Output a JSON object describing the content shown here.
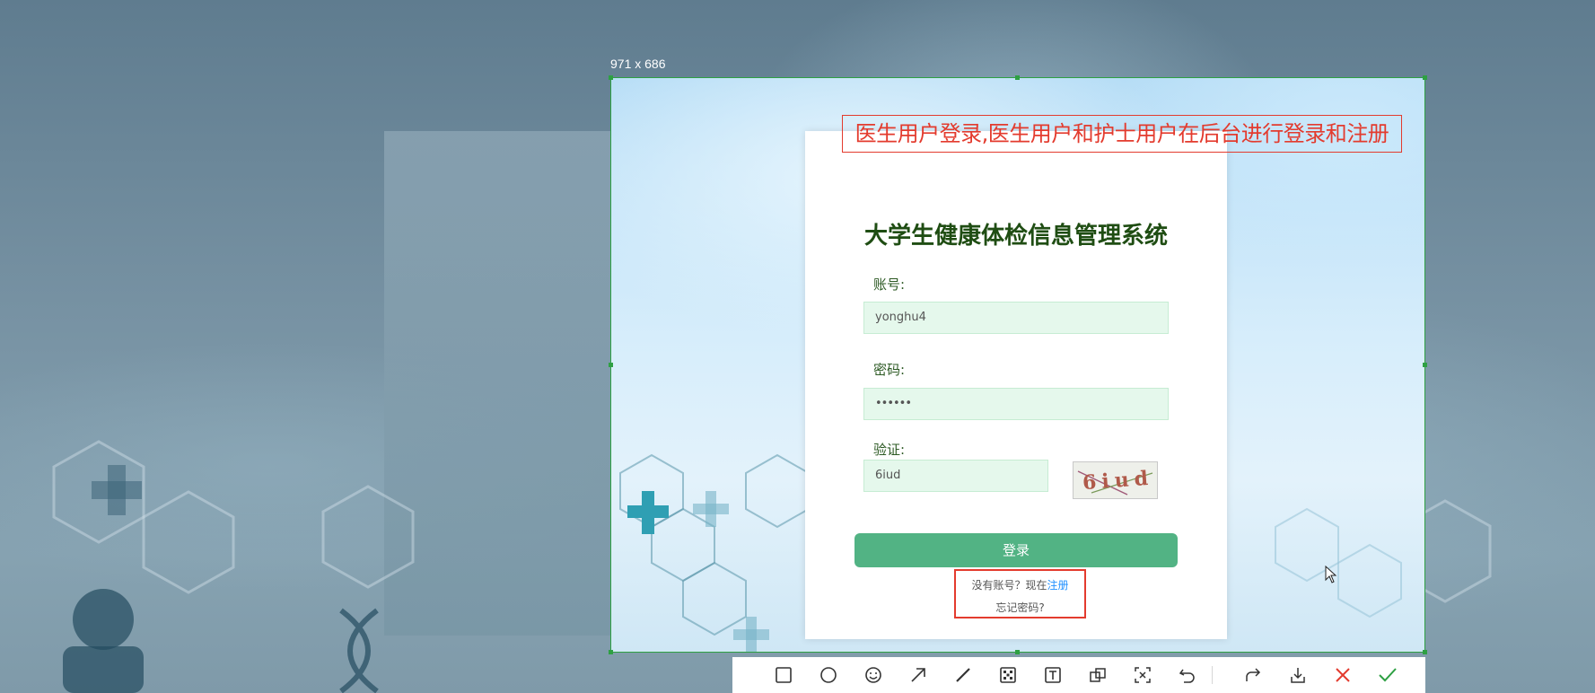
{
  "capture": {
    "size_label": "971 x 686"
  },
  "annotation": {
    "text": "医生用户登录,医生用户和护士用户在后台进行登录和注册"
  },
  "login": {
    "title": "大学生健康体检信息管理系统",
    "account_label": "账号:",
    "account_value": "yonghu4",
    "password_label": "密码:",
    "password_value": "••••••",
    "captcha_label": "验证:",
    "captcha_value": "6iud",
    "captcha_image_text": "6iud",
    "login_button": "登录",
    "register_prompt": "没有账号？现在",
    "register_link": "注册",
    "forgot_password": "忘记密码?"
  },
  "toolbar": {
    "tools": [
      "rectangle-icon",
      "ellipse-icon",
      "emoji-icon",
      "arrow-icon",
      "pen-icon",
      "mosaic-icon",
      "text-icon",
      "copy-icon",
      "ocr-icon",
      "undo-icon",
      "share-icon",
      "download-icon",
      "close-icon",
      "confirm-icon"
    ]
  },
  "colors": {
    "selection_border": "#2ea043",
    "annotation_red": "#e33b2e",
    "login_button": "#52b384",
    "title_green": "#1f4d13",
    "input_bg": "#e5f8ec",
    "link_blue": "#1f8fff"
  }
}
